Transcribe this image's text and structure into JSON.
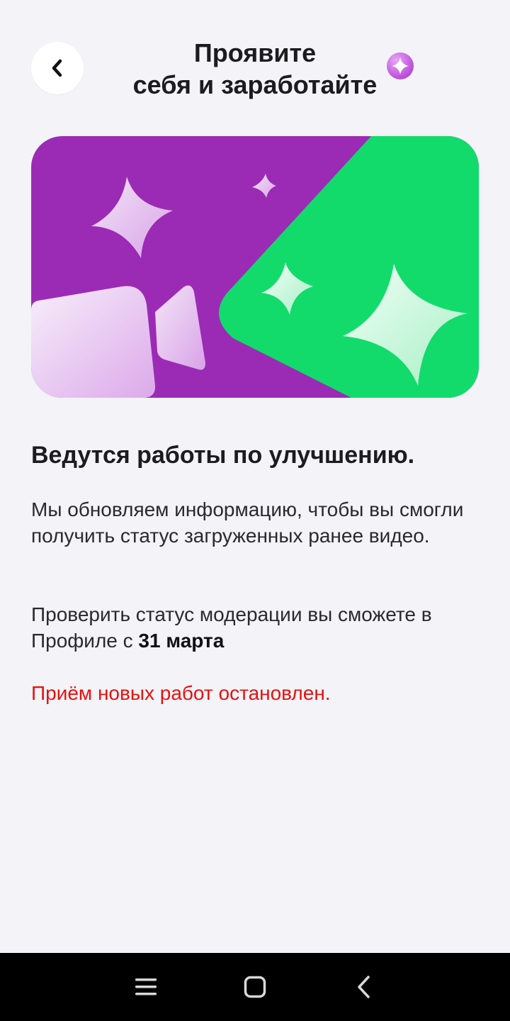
{
  "header": {
    "title_line1": "Проявите",
    "title_line2": "себя и заработайте"
  },
  "icons": {
    "back": "chevron-left-icon",
    "badge": "sparkle-badge-icon",
    "banner": "sparkles-illustration",
    "nav_menu": "recent-apps-icon",
    "nav_home": "home-icon",
    "nav_back": "nav-back-icon"
  },
  "colors": {
    "background": "#f3f3f8",
    "banner_purple": "#9b2bb5",
    "banner_green": "#12db6c",
    "warning": "#e5120f"
  },
  "content": {
    "heading": "Ведутся работы по улучшению.",
    "paragraph1": "Мы обновляем информацию, чтобы вы смогли получить статус загруженных ранее видео.",
    "paragraph2_prefix": "Проверить статус модерации вы сможете в Профиле с ",
    "paragraph2_bold": "31 марта",
    "warning": "Приём новых работ остановлен."
  }
}
